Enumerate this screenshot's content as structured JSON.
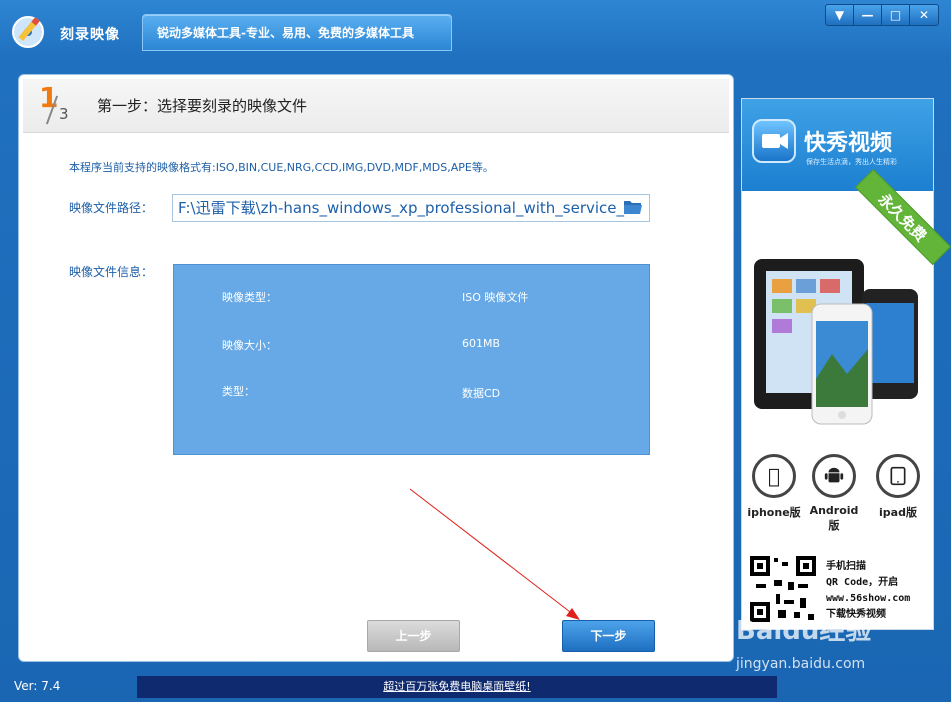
{
  "app": {
    "title": "刻录映像",
    "slogan": "锐动多媒体工具-专业、易用、免费的多媒体工具"
  },
  "window_controls": {
    "menu": "▼",
    "minimize": "—",
    "maximize": "□",
    "close": "✕"
  },
  "step": {
    "current": "1",
    "total": "3",
    "title": "第一步：选择要刻录的映像文件"
  },
  "supported_formats": "本程序当前支持的映像格式有:ISO,BIN,CUE,NRG,CCD,IMG,DVD,MDF,MDS,APE等。",
  "image_path": {
    "label": "映像文件路径：",
    "value": "F:\\迅雷下载\\zh-hans_windows_xp_professional_with_service_"
  },
  "image_info": {
    "label": "映像文件信息：",
    "rows": [
      {
        "key": "映像类型：",
        "value": "ISO 映像文件"
      },
      {
        "key": "映像大小：",
        "value": "601MB"
      },
      {
        "key": "类型：",
        "value": "数据CD"
      }
    ]
  },
  "buttons": {
    "prev": "上一步",
    "next": "下一步"
  },
  "ad": {
    "brand": "快秀视频",
    "tagline": "保存生活点滴，秀出人生精彩",
    "ribbon": "永久免费",
    "platforms": [
      "iphone版",
      "Android版",
      "ipad版"
    ],
    "qr_lines": [
      "手机扫描",
      "QR Code，开启",
      "www.56show.com",
      "下载快秀视频"
    ]
  },
  "footer": {
    "version": "Ver: 7.4",
    "banner": "超过百万张免费电脑桌面壁纸!"
  },
  "watermark": {
    "main": "Baidu经验",
    "sub": "jingyan.baidu.com"
  },
  "colors": {
    "accent": "#1f70bf",
    "info_box": "#67a9e6",
    "step_number": "#f07a10",
    "ribbon": "#62b538"
  }
}
